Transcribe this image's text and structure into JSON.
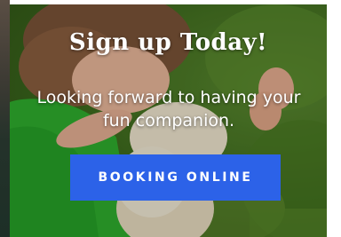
{
  "hero": {
    "image_description": "",
    "title": "Sign up Today!",
    "subtitle": "Looking forward to having your fun companion.",
    "cta_label": "BOOKING ONLINE"
  },
  "colors": {
    "cta_background": "#2c62e8",
    "text": "#ffffff",
    "grass": "#3b6a1c"
  }
}
